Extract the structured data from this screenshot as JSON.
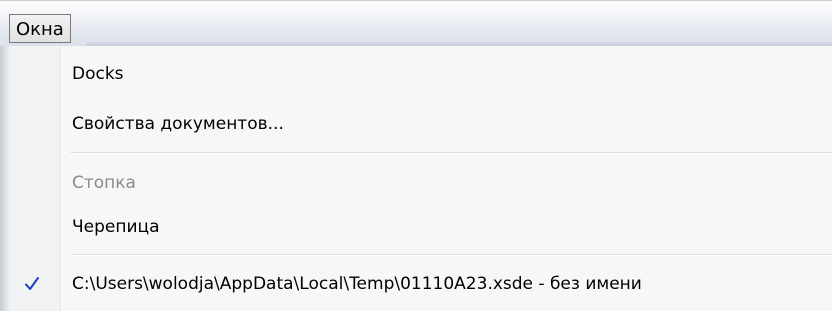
{
  "menubar": {
    "title": "Окна"
  },
  "menu": {
    "items": [
      {
        "label": "Docks",
        "enabled": true,
        "checked": false
      },
      {
        "label": "Свойства документов...",
        "enabled": true,
        "checked": false
      },
      {
        "label": "Стопка",
        "enabled": false,
        "checked": false
      },
      {
        "label": "Черепица",
        "enabled": true,
        "checked": false
      },
      {
        "label": "C:\\Users\\wolodja\\AppData\\Local\\Temp\\01110A23.xsde - без имени",
        "enabled": true,
        "checked": true
      }
    ],
    "check_icon": "checkmark-icon"
  },
  "colors": {
    "check": "#1a3fbf",
    "disabled_text": "#8a8a8a",
    "menu_background": "#f7f7f8"
  }
}
